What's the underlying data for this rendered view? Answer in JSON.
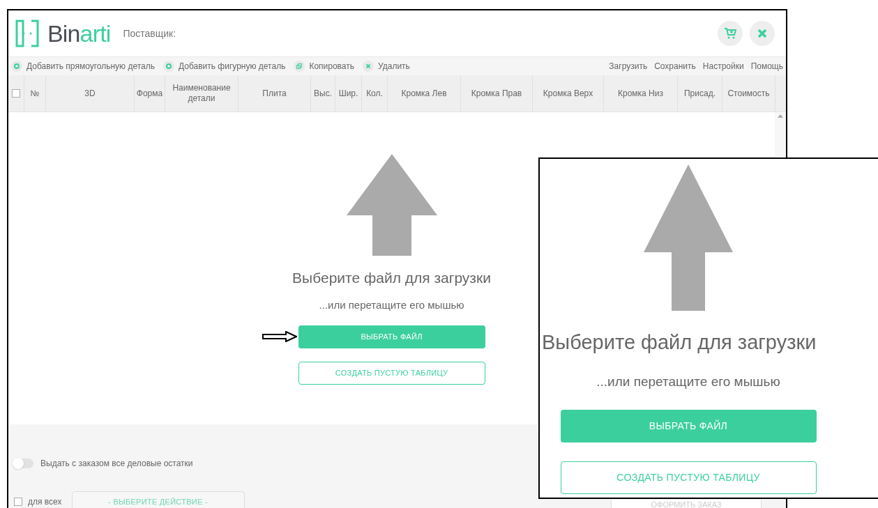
{
  "header": {
    "logo": {
      "dark": "Bin",
      "accent": "arti"
    },
    "supplier_label": "Поставщик:"
  },
  "toolbar": {
    "left": [
      {
        "kind": "add",
        "label": "Добавить прямоугольную деталь"
      },
      {
        "kind": "add",
        "label": "Добавить фигурную деталь"
      },
      {
        "kind": "copy",
        "label": "Копировать"
      },
      {
        "kind": "delete",
        "label": "Удалить"
      }
    ],
    "right": [
      "Загрузить",
      "Сохранить",
      "Настройки",
      "Помощь"
    ]
  },
  "table": {
    "select_all_checked": false,
    "columns": [
      "№",
      "3D",
      "Форма",
      "Наименование детали",
      "Плита",
      "Выс.",
      "Шир.",
      "Кол.",
      "Кромка Лев",
      "Кромка Прав",
      "Кромка Верх",
      "Кромка Низ",
      "Присад.",
      "Стоимость"
    ]
  },
  "upload": {
    "title": "Выберите файл для загрузки",
    "subtitle": "...или перетащите его мышью",
    "choose_button": "ВЫБРАТЬ ФАЙЛ",
    "empty_table_button": "СОЗДАТЬ ПУСТУЮ ТАБЛИЦУ"
  },
  "footer": {
    "toggle": {
      "label": "Выдать с заказом все деловые остатки",
      "on": false
    },
    "for_all": {
      "label": "для всех",
      "checked": false
    },
    "action_select": "- ВЫБЕРИТЕ ДЕЙСТВИЕ -",
    "order_button": "ОФОРМИТЬ ЗАКАЗ"
  },
  "inset": {
    "title": "Выберите файл для загрузки",
    "subtitle": "...или перетащите его мышью",
    "choose_button": "ВЫБРАТЬ ФАЙЛ",
    "empty_table_button": "СОЗДАТЬ ПУСТУЮ ТАБЛИЦУ"
  }
}
